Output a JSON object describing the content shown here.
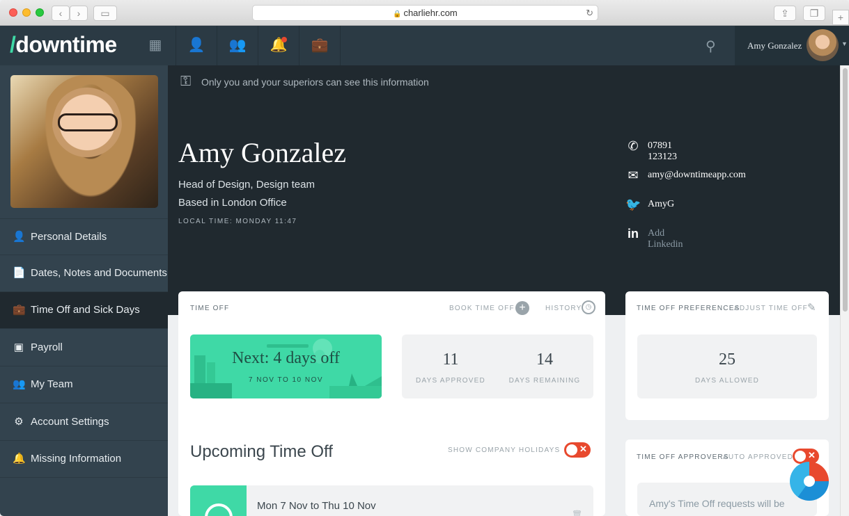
{
  "browser": {
    "url": "charliehr.com"
  },
  "nav": {
    "logo_slash": "/",
    "logo_text": "downtime",
    "user_name": "Amy Gonzalez"
  },
  "sidebar": {
    "items": [
      {
        "label": "Personal Details",
        "icon": "person-icon"
      },
      {
        "label": "Dates, Notes and Documents",
        "icon": "document-icon"
      },
      {
        "label": "Time Off and Sick Days",
        "icon": "suitcase-icon"
      },
      {
        "label": "Payroll",
        "icon": "wallet-icon"
      },
      {
        "label": "My Team",
        "icon": "team-icon"
      },
      {
        "label": "Account Settings",
        "icon": "gear-icon"
      },
      {
        "label": "Missing Information",
        "icon": "bell-icon"
      }
    ]
  },
  "profile": {
    "privacy_note": "Only you and your superiors can see this information",
    "name": "Amy Gonzalez",
    "role": "Head of Design, Design team",
    "location": "Based in London Office",
    "local_time": "LOCAL TIME: MONDAY 11:47",
    "phone": "07891 123123",
    "email": "amy@downtimeapp.com",
    "twitter": "AmyG",
    "linkedin": "Add Linkedin"
  },
  "time_off": {
    "title": "TIME OFF",
    "book": "BOOK TIME OFF",
    "history": "HISTORY",
    "next": "Next: 4 days off",
    "next_dates": "7 NOV TO 10 NOV",
    "approved_value": "11",
    "approved_label": "DAYS APPROVED",
    "remaining_value": "14",
    "remaining_label": "DAYS REMAINING",
    "upcoming_title": "Upcoming Time Off",
    "show_holidays": "SHOW COMPANY HOLIDAYS",
    "upcoming_item": "Mon 7 Nov to Thu 10 Nov"
  },
  "preferences": {
    "title": "TIME OFF PREFERENCES",
    "adjust": "ADJUST TIME OFF",
    "allowed_value": "25",
    "allowed_label": "DAYS ALLOWED"
  },
  "approvers": {
    "title": "TIME OFF APPROVERS",
    "status": "AUTO APPROVED",
    "note": "Amy's Time Off requests will be"
  },
  "colors": {
    "accent": "#3fd9a6",
    "nav": "#2b3a44",
    "hero": "#20292f",
    "toggle": "#e8492e"
  }
}
